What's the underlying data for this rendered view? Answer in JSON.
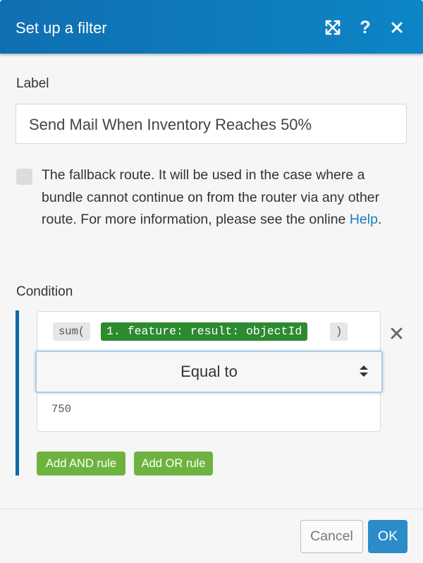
{
  "dialog": {
    "title": "Set up a filter",
    "icons": {
      "expand": "expand-icon",
      "help": "help-icon",
      "close": "close-icon"
    },
    "help_glyph": "?"
  },
  "label_field": {
    "heading": "Label",
    "value": "Send Mail When Inventory Reaches 50%"
  },
  "fallback": {
    "checked": false,
    "text": "The fallback route. It will be used in the case where a bundle cannot continue on from the router via any other route. For more information, please see the online ",
    "link": "Help",
    "suffix": "."
  },
  "condition": {
    "heading": "Condition",
    "rule": {
      "expression": {
        "fn_open": "sum(",
        "variable": "1. feature: result: objectId",
        "fn_close": ")"
      },
      "operator": "Equal to",
      "value": "750"
    },
    "add_and_label": "Add AND rule",
    "add_or_label": "Add OR rule"
  },
  "footer": {
    "cancel_label": "Cancel",
    "ok_label": "OK"
  },
  "colors": {
    "header": "#0d7bbd",
    "condition_bar": "#0d6aa8",
    "variable_pill": "#2c8a2f",
    "green_button": "#6eb33f",
    "ok_button": "#2c8bc9",
    "link": "#1a7cbd"
  }
}
